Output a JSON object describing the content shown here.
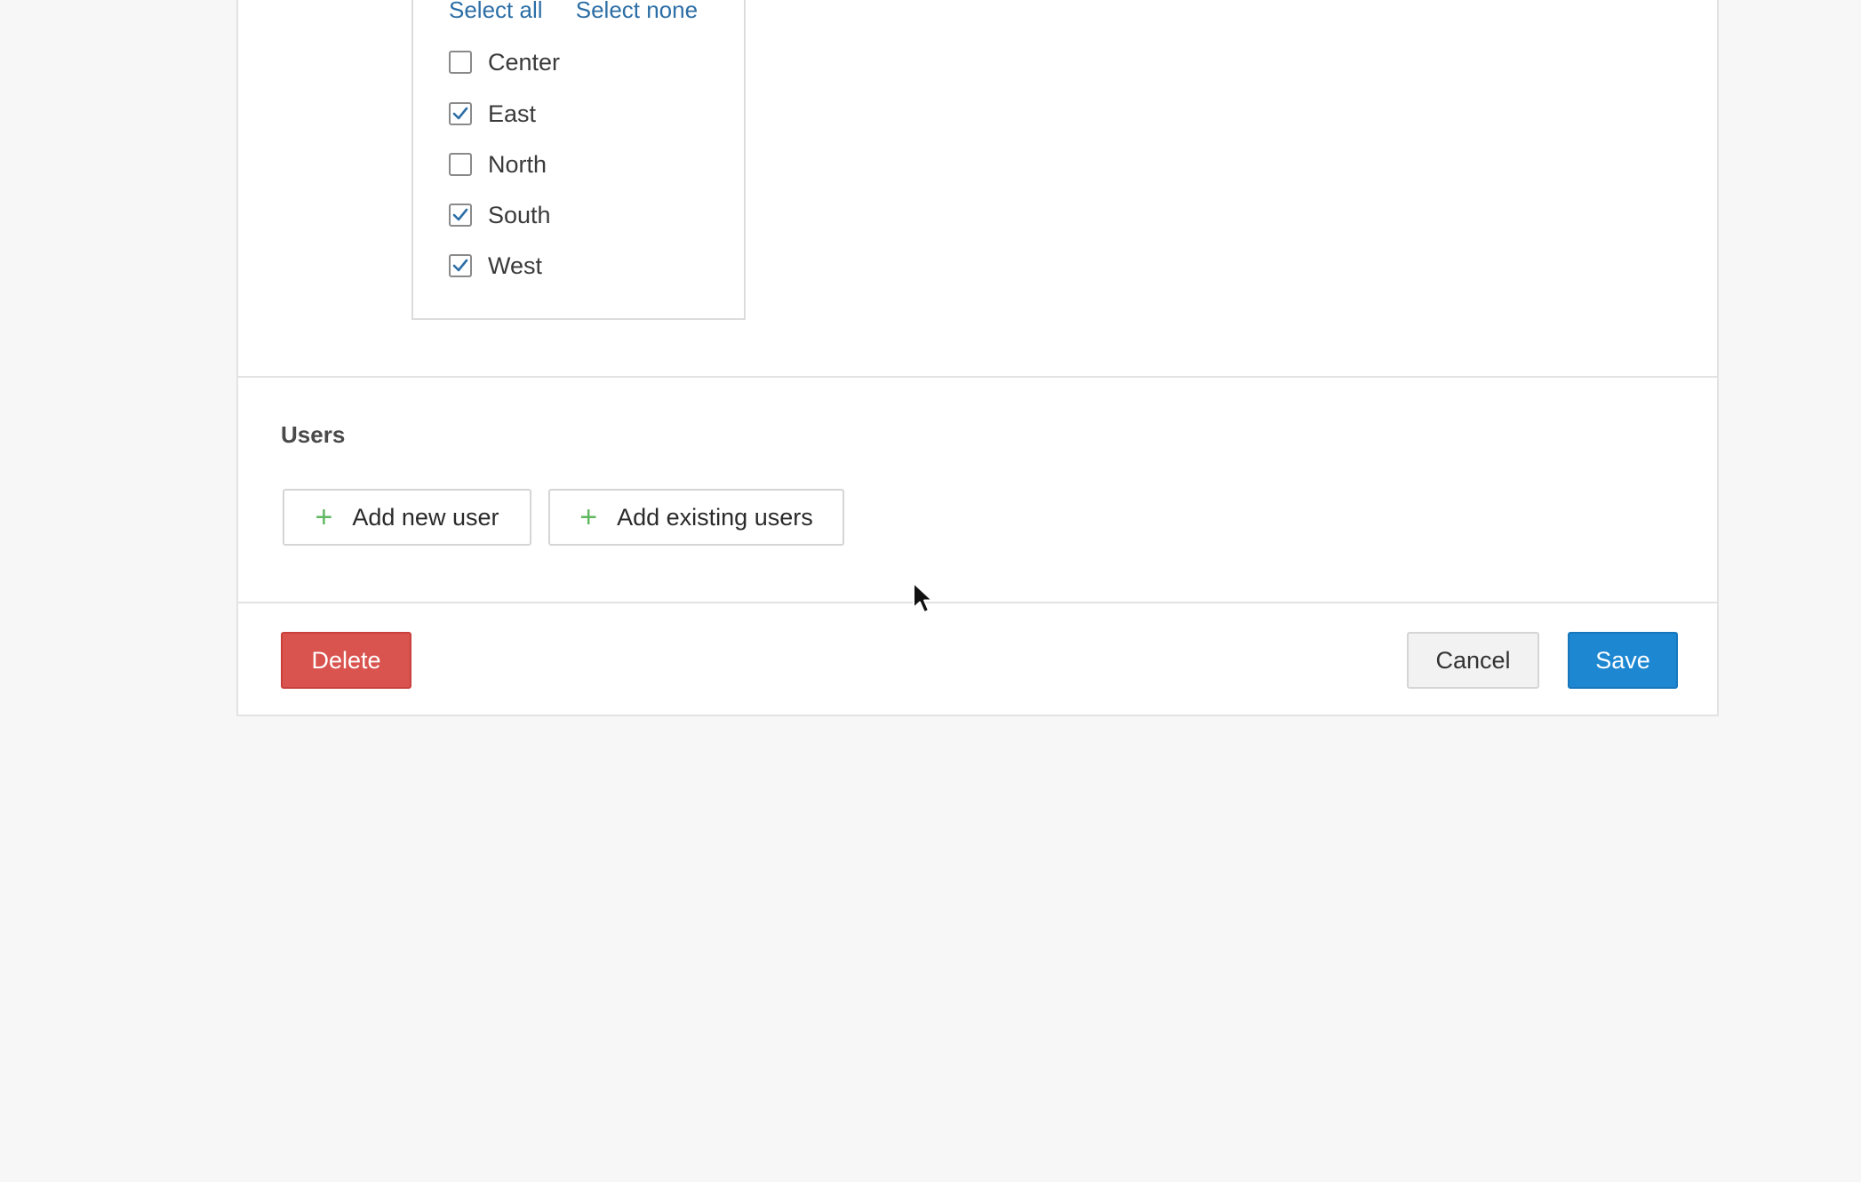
{
  "regions": {
    "select_all": "Select all",
    "select_none": "Select none",
    "items": [
      {
        "label": "Center",
        "checked": false
      },
      {
        "label": "East",
        "checked": true
      },
      {
        "label": "North",
        "checked": false
      },
      {
        "label": "South",
        "checked": true
      },
      {
        "label": "West",
        "checked": true
      }
    ]
  },
  "users": {
    "title": "Users",
    "add_new_label": "Add new user",
    "add_existing_label": "Add existing users"
  },
  "footer": {
    "delete_label": "Delete",
    "cancel_label": "Cancel",
    "save_label": "Save"
  },
  "icons": {
    "plus": "plus-icon",
    "check": "check-icon",
    "cursor": "mouse-cursor-icon"
  },
  "colors": {
    "link": "#2c6ea6",
    "plus": "#5fb760",
    "delete": "#d9534f",
    "save": "#1d87d2"
  }
}
